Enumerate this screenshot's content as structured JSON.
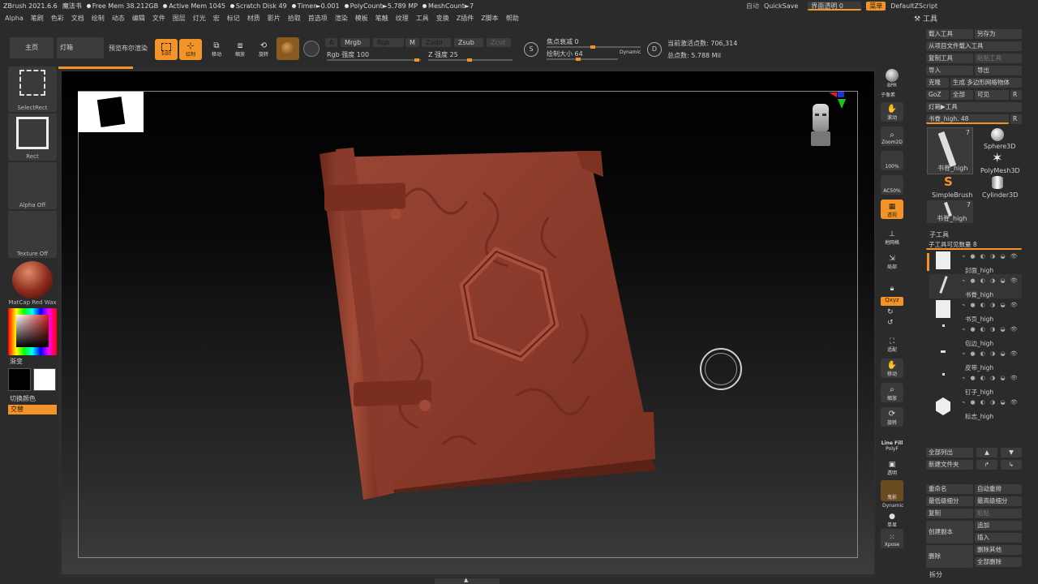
{
  "titlebar": {
    "app": "ZBrush 2021.6.6",
    "doc": "魔法书",
    "free_mem": "Free Mem 38.212GB",
    "active_mem": "Active Mem 1045",
    "scratch_disk": "Scratch Disk 49",
    "timer": "Timer►0.001",
    "polycount": "PolyCount►5.789 MP",
    "meshcount": "MeshCount►7",
    "auto_label": "自动",
    "quicksave": "QuickSave",
    "transparency": "界面透明 0",
    "menu_btn": "菜单",
    "script": "DefaultZScript"
  },
  "menubar": {
    "items": [
      "Alpha",
      "笔刷",
      "色彩",
      "文档",
      "绘制",
      "动态",
      "编辑",
      "文件",
      "图层",
      "灯光",
      "宏",
      "标记",
      "材质",
      "影片",
      "拾取",
      "首选项",
      "渲染",
      "模板",
      "笔触",
      "纹理",
      "工具",
      "变换",
      "Z插件",
      "Z脚本",
      "帮助"
    ]
  },
  "toolbar": {
    "home": "主页",
    "lightbox": "灯箱",
    "bpr_preview": "预览布尔渲染",
    "edit": "Edit",
    "draw": "绘制",
    "move": "移动",
    "scale": "缩放",
    "rotate": "旋转",
    "a_btn": "A",
    "mrgb": "Mrgb",
    "rgb": "Rgb",
    "m": "M",
    "zadd": "Zadd",
    "zsub": "Zsub",
    "zcut": "Zcut",
    "rgb_intensity": "Rgb 强度 100",
    "z_intensity": "Z 强度 25",
    "focal_shift": "焦点衰减 0",
    "draw_size": "绘制大小 64",
    "dynamic": "Dynamic",
    "s_label": "S",
    "d_label": "D",
    "active_points": "当前激活点数: 706,314",
    "total_points": "总点数: 5.788 Mil"
  },
  "leftpanel": {
    "selectrect": "SelectRect",
    "rect": "Rect",
    "alpha_off": "Alpha Off",
    "texture_off": "Texture Off",
    "matcap": "MatCap Red Wax",
    "gradient": "渐变",
    "switch_color": "切换颜色",
    "alternate": "交替"
  },
  "rightshelf": {
    "bpr": "BPR",
    "subpixel": "子像素",
    "scroll": "滚动",
    "zoom2d": "Zoom2D",
    "p100": "100%",
    "ac50": "AC50%",
    "persp": "透视",
    "floor": "地网格",
    "local": "局部",
    "xyz": "Qxyz",
    "frame": "适配",
    "move": "移动",
    "zoom3d": "缩放",
    "rotate": "旋转",
    "linefill": "Line Fill",
    "polyf": "PolyF",
    "transp": "透明",
    "ghost": "鬼影",
    "dynamic": "Dynamic",
    "solo": "单显",
    "xpose": "Xpose"
  },
  "toolpanel": {
    "title": "工具",
    "load_tool": "载入工具",
    "save_as": "另存为",
    "load_project": "从项目文件载入工具",
    "copy_tool": "复制工具",
    "paste_tool": "粘贴工具",
    "import": "导入",
    "export": "导出",
    "clone": "克隆",
    "make_polymesh": "生成 多边形网格物体",
    "goz": "GoZ",
    "all": "全部",
    "visible": "可见",
    "r": "R",
    "lightbox_tools": "灯箱▶工具",
    "current_tool": "书脊_high. 48",
    "thumbs": [
      {
        "label": "书脊_high",
        "count": "7"
      },
      {
        "label": "Sphere3D"
      },
      {
        "label": "PolyMesh3D"
      },
      {
        "label": "SimpleBrush"
      },
      {
        "label": "Cylinder3D"
      },
      {
        "label": "书脊_high",
        "count": "7"
      }
    ],
    "subtool_title": "子工具",
    "subtool_visible_count": "子工具可见数量 8",
    "subtools": [
      "封面_high",
      "书脊_high",
      "书页_high",
      "包边_high",
      "皮带_high",
      "钉子_high",
      "标志_high"
    ],
    "list_all": "全部列出",
    "new_folder": "新建文件夹",
    "rename": "重命名",
    "auto_reorder": "自动重排",
    "lowest_subdiv": "最低级细分",
    "highest_subdiv": "最高级细分",
    "copy": "复制",
    "paste": "粘贴",
    "duplicate": "创建副本",
    "append": "追加",
    "insert": "插入",
    "delete": "删除",
    "delete_other": "删除其他",
    "delete_all": "全部删除",
    "split": "拆分"
  },
  "colors": {
    "accent": "#f39428",
    "book": "#8a3a2a",
    "panel": "#2b2b2b"
  }
}
